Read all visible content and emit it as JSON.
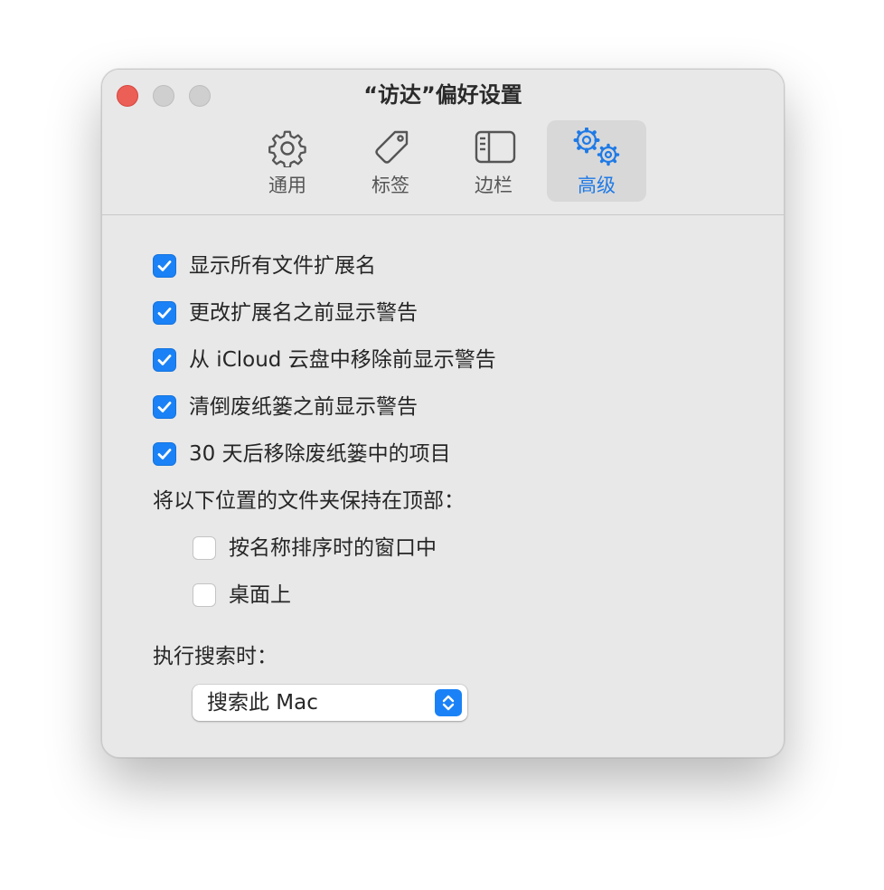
{
  "window": {
    "title": "“访达”偏好设置"
  },
  "tabs": [
    {
      "label": "通用",
      "icon": "gear-icon",
      "active": false
    },
    {
      "label": "标签",
      "icon": "tag-icon",
      "active": false
    },
    {
      "label": "边栏",
      "icon": "sidebar-icon",
      "active": false
    },
    {
      "label": "高级",
      "icon": "gears-icon",
      "active": true
    }
  ],
  "options": [
    {
      "label": "显示所有文件扩展名",
      "checked": true
    },
    {
      "label": "更改扩展名之前显示警告",
      "checked": true
    },
    {
      "label": "从 iCloud 云盘中移除前显示警告",
      "checked": true
    },
    {
      "label": "清倒废纸篓之前显示警告",
      "checked": true
    },
    {
      "label": "30 天后移除废纸篓中的项目",
      "checked": true
    }
  ],
  "folders_top": {
    "heading": "将以下位置的文件夹保持在顶部：",
    "items": [
      {
        "label": "按名称排序时的窗口中",
        "checked": false
      },
      {
        "label": "桌面上",
        "checked": false
      }
    ]
  },
  "search": {
    "heading": "执行搜索时：",
    "selected": "搜索此 Mac"
  },
  "colors": {
    "accent": "#1a82f6",
    "close": "#ec5f57"
  }
}
